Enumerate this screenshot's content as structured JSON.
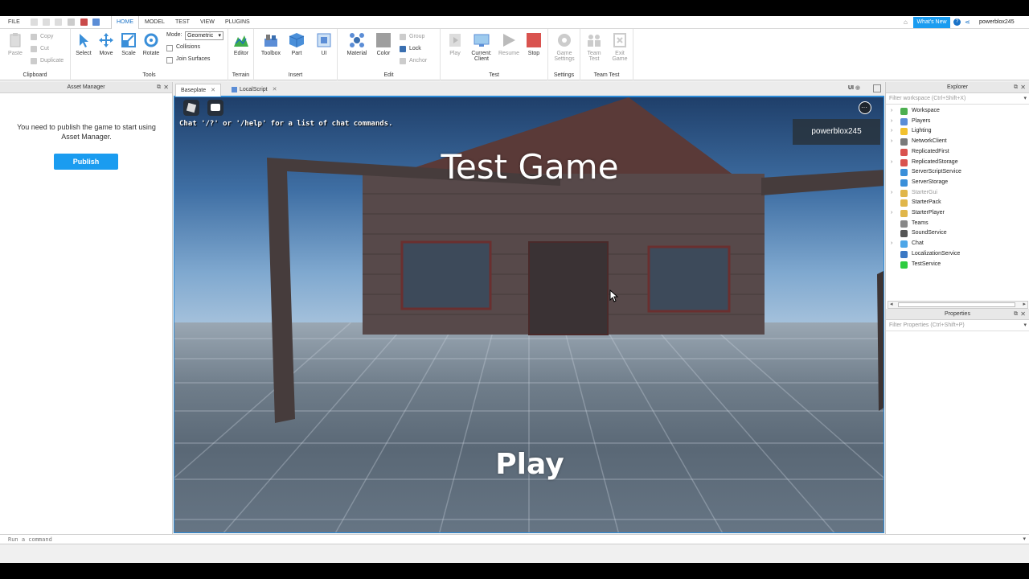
{
  "menubar": {
    "tabs": [
      "FILE",
      "HOME",
      "MODEL",
      "TEST",
      "VIEW",
      "PLUGINS"
    ],
    "active_tab": "HOME",
    "whats_new": "What's New",
    "username": "powerblox245"
  },
  "ribbon": {
    "clipboard": {
      "label": "Clipboard",
      "paste": "Paste",
      "copy": "Copy",
      "cut": "Cut",
      "duplicate": "Duplicate"
    },
    "tools": {
      "label": "Tools",
      "select": "Select",
      "move": "Move",
      "scale": "Scale",
      "rotate": "Rotate",
      "mode_label": "Mode:",
      "mode_value": "Geometric",
      "collisions": "Collisions",
      "join_surfaces": "Join Surfaces"
    },
    "terrain": {
      "label": "Terrain",
      "editor": "Editor"
    },
    "insert": {
      "label": "Insert",
      "toolbox": "Toolbox",
      "part": "Part",
      "ui": "UI"
    },
    "edit": {
      "label": "Edit",
      "material": "Material",
      "color": "Color",
      "group": "Group",
      "lock": "Lock",
      "anchor": "Anchor"
    },
    "test": {
      "label": "Test",
      "play": "Play",
      "current_line1": "Current:",
      "current_line2": "Client",
      "resume": "Resume",
      "stop": "Stop"
    },
    "settings": {
      "label": "Settings",
      "game_line1": "Game",
      "game_line2": "Settings"
    },
    "team_test": {
      "label": "Team Test",
      "team_line1": "Team",
      "team_line2": "Test",
      "exit_line1": "Exit",
      "exit_line2": "Game"
    }
  },
  "asset_manager": {
    "title": "Asset Manager",
    "message": "You need to publish the game to start using Asset Manager.",
    "publish": "Publish"
  },
  "doc_tabs": [
    {
      "label": "Baseplate"
    },
    {
      "label": "LocalScript"
    }
  ],
  "ui_toggle": "UI",
  "viewport": {
    "chat_hint": "Chat '/?' or '/help' for a list of chat commands.",
    "player_name": "powerblox245",
    "game_title": "Test Game",
    "play": "Play"
  },
  "explorer": {
    "title": "Explorer",
    "filter_placeholder": "Filter workspace (Ctrl+Shift+X)",
    "items": [
      {
        "label": "Workspace",
        "expandable": true,
        "color": "#4caf50",
        "dim": false
      },
      {
        "label": "Players",
        "expandable": true,
        "color": "#5b8dd6",
        "dim": false
      },
      {
        "label": "Lighting",
        "expandable": true,
        "color": "#f2c12e",
        "dim": false
      },
      {
        "label": "NetworkClient",
        "expandable": true,
        "color": "#7a7a7a",
        "dim": false
      },
      {
        "label": "ReplicatedFirst",
        "expandable": false,
        "color": "#d9534f",
        "dim": false
      },
      {
        "label": "ReplicatedStorage",
        "expandable": true,
        "color": "#d9534f",
        "dim": false
      },
      {
        "label": "ServerScriptService",
        "expandable": false,
        "color": "#3a8fd9",
        "dim": false
      },
      {
        "label": "ServerStorage",
        "expandable": false,
        "color": "#3a8fd9",
        "dim": false
      },
      {
        "label": "StarterGui",
        "expandable": true,
        "color": "#e0b64a",
        "dim": true
      },
      {
        "label": "StarterPack",
        "expandable": false,
        "color": "#e0b64a",
        "dim": false
      },
      {
        "label": "StarterPlayer",
        "expandable": true,
        "color": "#e0b64a",
        "dim": false
      },
      {
        "label": "Teams",
        "expandable": false,
        "color": "#888888",
        "dim": false
      },
      {
        "label": "SoundService",
        "expandable": false,
        "color": "#555555",
        "dim": false
      },
      {
        "label": "Chat",
        "expandable": true,
        "color": "#4da6e8",
        "dim": false
      },
      {
        "label": "LocalizationService",
        "expandable": false,
        "color": "#3b78c4",
        "dim": false
      },
      {
        "label": "TestService",
        "expandable": false,
        "color": "#2ecc40",
        "dim": false
      }
    ]
  },
  "properties": {
    "title": "Properties",
    "filter_placeholder": "Filter Properties (Ctrl+Shift+P)"
  },
  "command_bar": {
    "placeholder": "Run a command"
  },
  "colors": {
    "accent": "#1a9cf0",
    "selection_border": "#2d8bd8"
  }
}
